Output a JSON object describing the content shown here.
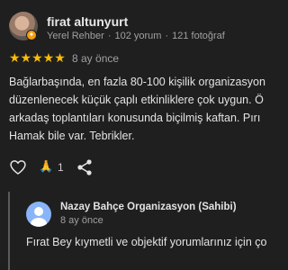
{
  "review": {
    "author": {
      "name": "firat altunyurt",
      "badge": "Yerel Rehber",
      "reviews": "102 yorum",
      "photos": "121 fotoğraf",
      "separator": "·"
    },
    "rating": {
      "value": 5,
      "max": 5,
      "stars": "★★★★★",
      "color": "#fbbc04"
    },
    "date": "8 ay önce",
    "text_lines": [
      "Bağlarbaşında, en fazla 80-100 kişilik organizasyon",
      "düzenlenecek küçük çaplı etkinliklere çok uygun. Ö",
      "arkadaş toplantıları konusunda biçilmiş kaftan. Pırı",
      "Hamak bile var. Tebrikler."
    ],
    "actions": {
      "like_icon": "heart-outline-icon",
      "reaction_emoji": "🙏",
      "reaction_count": "1",
      "share_icon": "share-icon"
    }
  },
  "owner_reply": {
    "name": "Nazay Bahçe Organizasyon (Sahibi)",
    "date": "8 ay önce",
    "text": "Fırat Bey kıymetli ve objektif yorumlarınız için ço"
  }
}
